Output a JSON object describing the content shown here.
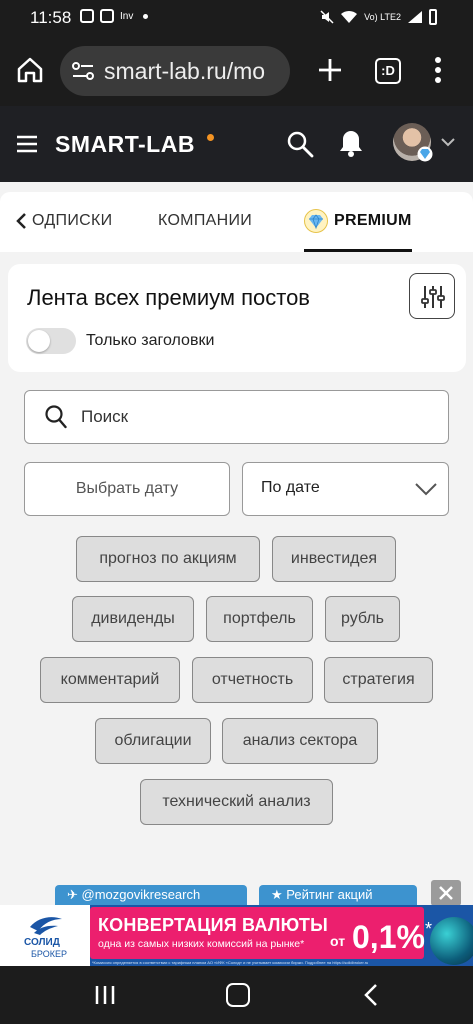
{
  "status_bar": {
    "time": "11:58",
    "notif_text": "Inv",
    "network": "Vo) LTE2"
  },
  "browser": {
    "url": "smart-lab.ru/mo",
    "tabs_count": ":D"
  },
  "header": {
    "logo": "SMART-LAB",
    "accent_color": "#f39323"
  },
  "tabs": [
    {
      "label": "ОДПИСКИ"
    },
    {
      "label": "КОМПАНИИ"
    },
    {
      "label": "PREMIUM",
      "active": true
    }
  ],
  "feed": {
    "title": "Лента всех премиум постов",
    "toggle_label": "Только заголовки",
    "toggle_on": false
  },
  "search": {
    "placeholder": "Поиск"
  },
  "filters": {
    "date_button": "Выбрать дату",
    "sort_value": "По дате"
  },
  "tags": [
    "прогноз по акциям",
    "инвестидея",
    "дивиденды",
    "портфель",
    "рубль",
    "комментарий",
    "отчетность",
    "стратегия",
    "облигации",
    "анализ сектора",
    "технический анализ"
  ],
  "floating_buttons": {
    "telegram": "@mozgovikresearch",
    "rating": "Рейтинг акций"
  },
  "ad": {
    "brand": "СОЛИД",
    "brand_sub": "БРОКЕР",
    "headline": "КОНВЕРТАЦИЯ ВАЛЮТЫ",
    "subline": "одна из самых низких комиссий на рынке*",
    "prefix": "от",
    "rate": "0,1%",
    "rate_mark": "*",
    "fine_print": "*Комиссия определяется в соответствии с тарифным планом АО «ИФК «Солид» и не учитывает комиссии биржи. Подробнее на https://solidbroker.ru"
  }
}
